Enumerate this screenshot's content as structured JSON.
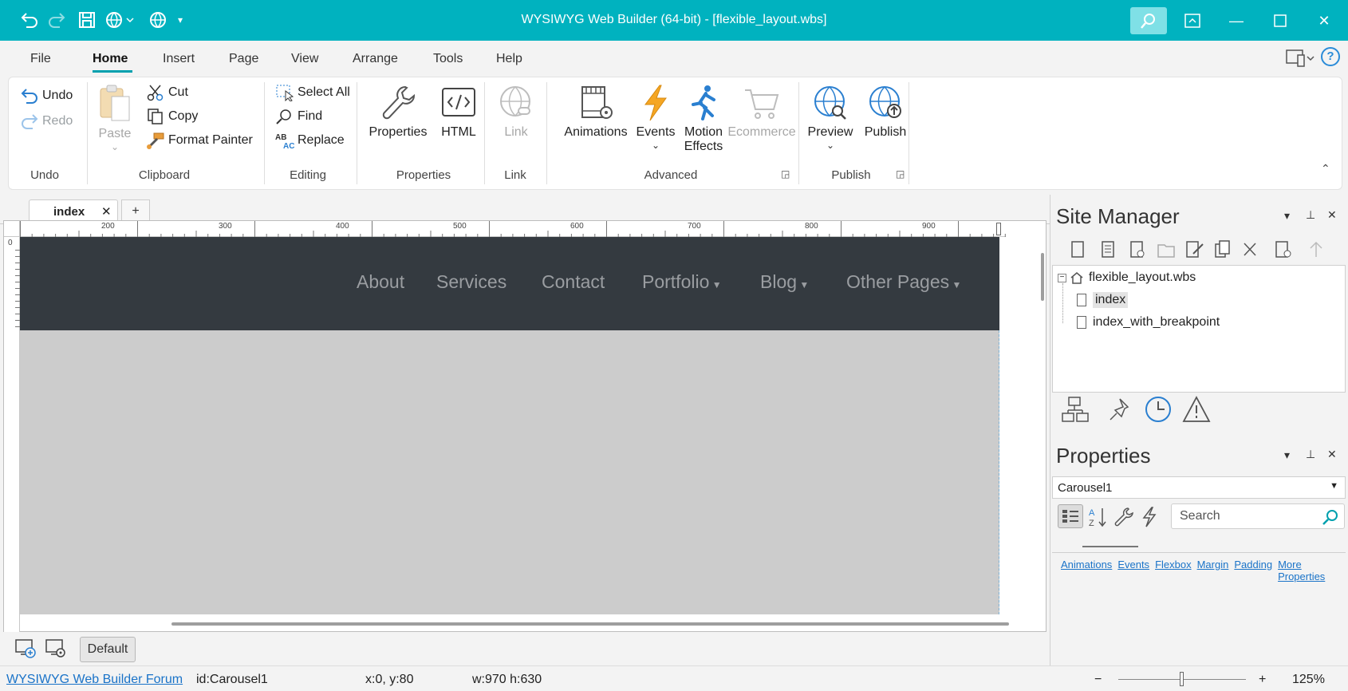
{
  "titlebar": {
    "title": "WYSIWYG Web Builder (64-bit) - [flexible_layout.wbs]",
    "quick_access": [
      "undo-icon",
      "redo-icon",
      "save-icon",
      "preview-web-icon",
      "publish-web-icon",
      "customize-icon"
    ]
  },
  "menu": {
    "tabs": [
      "File",
      "Home",
      "Insert",
      "Page",
      "View",
      "Arrange",
      "Tools",
      "Help"
    ],
    "active": "Home"
  },
  "ribbon": {
    "undo_group": {
      "undo": "Undo",
      "redo": "Redo",
      "label": "Undo"
    },
    "clipboard_group": {
      "paste": "Paste",
      "cut": "Cut",
      "copy": "Copy",
      "format_painter": "Format Painter",
      "label": "Clipboard"
    },
    "editing_group": {
      "select_all": "Select All",
      "find": "Find",
      "replace": "Replace",
      "label": "Editing"
    },
    "properties_group": {
      "properties": "Properties",
      "html": "HTML",
      "label": "Properties"
    },
    "link_group": {
      "link": "Link",
      "label": "Link"
    },
    "advanced_group": {
      "animations": "Animations",
      "events": "Events",
      "motion_effects_1": "Motion",
      "motion_effects_2": "Effects",
      "ecommerce": "Ecommerce",
      "label": "Advanced"
    },
    "publish_group": {
      "preview": "Preview",
      "publish": "Publish",
      "label": "Publish"
    }
  },
  "document": {
    "tab_label": "index",
    "add_tab": "+",
    "ruler_labels": [
      "200",
      "300",
      "400",
      "500",
      "600",
      "700",
      "800",
      "900"
    ],
    "ruler_zero": "0",
    "nav_items": [
      "About",
      "Services",
      "Contact",
      "Portfolio",
      "Blog",
      "Other Pages"
    ],
    "default_button": "Default"
  },
  "site_manager": {
    "title": "Site Manager",
    "root": "flexible_layout.wbs",
    "pages": [
      "index",
      "index_with_breakpoint"
    ],
    "selected": "index"
  },
  "properties_panel": {
    "title": "Properties",
    "selected_object": "Carousel1",
    "search_placeholder": "Search",
    "links": [
      "Animations",
      "Events",
      "Flexbox",
      "Margin",
      "Padding",
      "More Properties"
    ]
  },
  "statusbar": {
    "forum_link": "WYSIWYG Web Builder Forum",
    "id": "id:Carousel1",
    "position": "x:0, y:80",
    "size": "w:970 h:630",
    "zoom": "125%",
    "zoom_minus": "−",
    "zoom_plus": "+"
  },
  "colors": {
    "titlebar": "#00b2bf",
    "navbar": "#343a40",
    "carousel": "#cccccc",
    "link": "#1a73c8"
  }
}
